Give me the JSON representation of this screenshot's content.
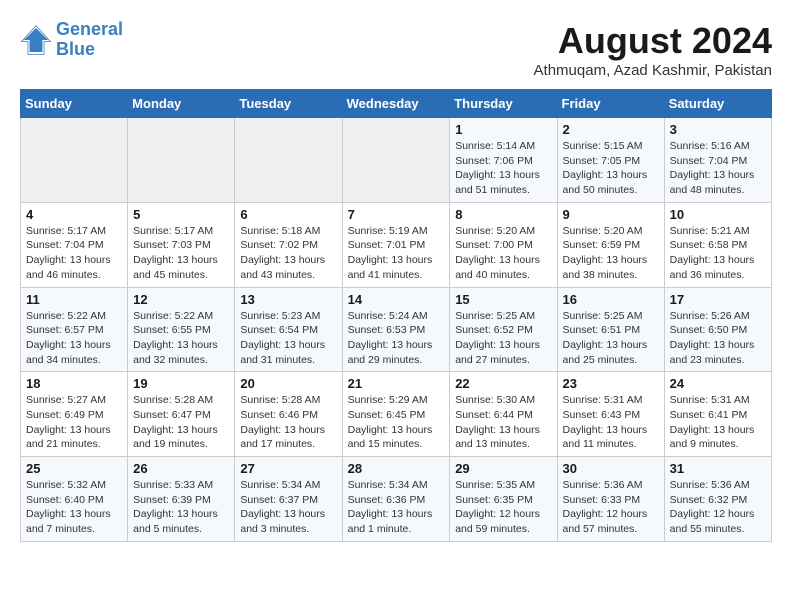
{
  "logo": {
    "line1": "General",
    "line2": "Blue"
  },
  "title": "August 2024",
  "subtitle": "Athmuqam, Azad Kashmir, Pakistan",
  "headers": [
    "Sunday",
    "Monday",
    "Tuesday",
    "Wednesday",
    "Thursday",
    "Friday",
    "Saturday"
  ],
  "weeks": [
    [
      {
        "day": "",
        "info": ""
      },
      {
        "day": "",
        "info": ""
      },
      {
        "day": "",
        "info": ""
      },
      {
        "day": "",
        "info": ""
      },
      {
        "day": "1",
        "info": "Sunrise: 5:14 AM\nSunset: 7:06 PM\nDaylight: 13 hours\nand 51 minutes."
      },
      {
        "day": "2",
        "info": "Sunrise: 5:15 AM\nSunset: 7:05 PM\nDaylight: 13 hours\nand 50 minutes."
      },
      {
        "day": "3",
        "info": "Sunrise: 5:16 AM\nSunset: 7:04 PM\nDaylight: 13 hours\nand 48 minutes."
      }
    ],
    [
      {
        "day": "4",
        "info": "Sunrise: 5:17 AM\nSunset: 7:04 PM\nDaylight: 13 hours\nand 46 minutes."
      },
      {
        "day": "5",
        "info": "Sunrise: 5:17 AM\nSunset: 7:03 PM\nDaylight: 13 hours\nand 45 minutes."
      },
      {
        "day": "6",
        "info": "Sunrise: 5:18 AM\nSunset: 7:02 PM\nDaylight: 13 hours\nand 43 minutes."
      },
      {
        "day": "7",
        "info": "Sunrise: 5:19 AM\nSunset: 7:01 PM\nDaylight: 13 hours\nand 41 minutes."
      },
      {
        "day": "8",
        "info": "Sunrise: 5:20 AM\nSunset: 7:00 PM\nDaylight: 13 hours\nand 40 minutes."
      },
      {
        "day": "9",
        "info": "Sunrise: 5:20 AM\nSunset: 6:59 PM\nDaylight: 13 hours\nand 38 minutes."
      },
      {
        "day": "10",
        "info": "Sunrise: 5:21 AM\nSunset: 6:58 PM\nDaylight: 13 hours\nand 36 minutes."
      }
    ],
    [
      {
        "day": "11",
        "info": "Sunrise: 5:22 AM\nSunset: 6:57 PM\nDaylight: 13 hours\nand 34 minutes."
      },
      {
        "day": "12",
        "info": "Sunrise: 5:22 AM\nSunset: 6:55 PM\nDaylight: 13 hours\nand 32 minutes."
      },
      {
        "day": "13",
        "info": "Sunrise: 5:23 AM\nSunset: 6:54 PM\nDaylight: 13 hours\nand 31 minutes."
      },
      {
        "day": "14",
        "info": "Sunrise: 5:24 AM\nSunset: 6:53 PM\nDaylight: 13 hours\nand 29 minutes."
      },
      {
        "day": "15",
        "info": "Sunrise: 5:25 AM\nSunset: 6:52 PM\nDaylight: 13 hours\nand 27 minutes."
      },
      {
        "day": "16",
        "info": "Sunrise: 5:25 AM\nSunset: 6:51 PM\nDaylight: 13 hours\nand 25 minutes."
      },
      {
        "day": "17",
        "info": "Sunrise: 5:26 AM\nSunset: 6:50 PM\nDaylight: 13 hours\nand 23 minutes."
      }
    ],
    [
      {
        "day": "18",
        "info": "Sunrise: 5:27 AM\nSunset: 6:49 PM\nDaylight: 13 hours\nand 21 minutes."
      },
      {
        "day": "19",
        "info": "Sunrise: 5:28 AM\nSunset: 6:47 PM\nDaylight: 13 hours\nand 19 minutes."
      },
      {
        "day": "20",
        "info": "Sunrise: 5:28 AM\nSunset: 6:46 PM\nDaylight: 13 hours\nand 17 minutes."
      },
      {
        "day": "21",
        "info": "Sunrise: 5:29 AM\nSunset: 6:45 PM\nDaylight: 13 hours\nand 15 minutes."
      },
      {
        "day": "22",
        "info": "Sunrise: 5:30 AM\nSunset: 6:44 PM\nDaylight: 13 hours\nand 13 minutes."
      },
      {
        "day": "23",
        "info": "Sunrise: 5:31 AM\nSunset: 6:43 PM\nDaylight: 13 hours\nand 11 minutes."
      },
      {
        "day": "24",
        "info": "Sunrise: 5:31 AM\nSunset: 6:41 PM\nDaylight: 13 hours\nand 9 minutes."
      }
    ],
    [
      {
        "day": "25",
        "info": "Sunrise: 5:32 AM\nSunset: 6:40 PM\nDaylight: 13 hours\nand 7 minutes."
      },
      {
        "day": "26",
        "info": "Sunrise: 5:33 AM\nSunset: 6:39 PM\nDaylight: 13 hours\nand 5 minutes."
      },
      {
        "day": "27",
        "info": "Sunrise: 5:34 AM\nSunset: 6:37 PM\nDaylight: 13 hours\nand 3 minutes."
      },
      {
        "day": "28",
        "info": "Sunrise: 5:34 AM\nSunset: 6:36 PM\nDaylight: 13 hours\nand 1 minute."
      },
      {
        "day": "29",
        "info": "Sunrise: 5:35 AM\nSunset: 6:35 PM\nDaylight: 12 hours\nand 59 minutes."
      },
      {
        "day": "30",
        "info": "Sunrise: 5:36 AM\nSunset: 6:33 PM\nDaylight: 12 hours\nand 57 minutes."
      },
      {
        "day": "31",
        "info": "Sunrise: 5:36 AM\nSunset: 6:32 PM\nDaylight: 12 hours\nand 55 minutes."
      }
    ]
  ]
}
